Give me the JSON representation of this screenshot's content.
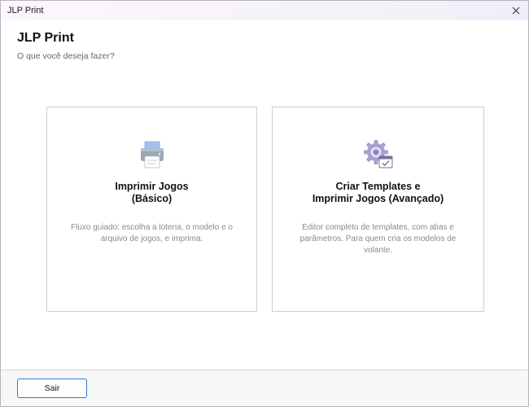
{
  "window": {
    "title": "JLP Print"
  },
  "header": {
    "title": "JLP Print",
    "subtitle": "O que você deseja fazer?"
  },
  "cards": [
    {
      "icon": "printer-icon",
      "title_line1": "Imprimir Jogos",
      "title_line2": "(Básico)",
      "description": "Fluxo guiado: escolha a loteria, o modelo e o arquivo de jogos, e imprima."
    },
    {
      "icon": "gear-template-icon",
      "title_line1": "Criar Templates e",
      "title_line2": "Imprimir Jogos (Avançado)",
      "description": "Editor completo de templates, com abas e parâmetros. Para quem cria os modelos de volante."
    }
  ],
  "footer": {
    "exit_label": "Sair"
  },
  "colors": {
    "accent": "#2e7ad8",
    "card_border": "#cfcfcf",
    "description_text": "#8a8a8a"
  }
}
